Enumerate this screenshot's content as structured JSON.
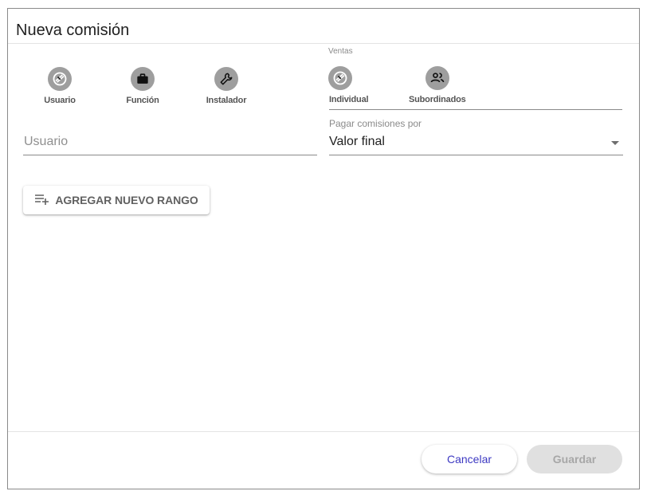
{
  "dialog": {
    "title": "Nueva comisión"
  },
  "assign_type": {
    "options": [
      {
        "label": "Usuario",
        "icon": "user-shield-icon"
      },
      {
        "label": "Función",
        "icon": "briefcase-icon"
      },
      {
        "label": "Instalador",
        "icon": "wrench-icon"
      }
    ]
  },
  "ventas": {
    "label": "Ventas",
    "options": [
      {
        "label": "Individual",
        "icon": "user-shield-icon"
      },
      {
        "label": "Subordinados",
        "icon": "people-icon"
      }
    ]
  },
  "user_field": {
    "placeholder": "Usuario",
    "value": ""
  },
  "pay_by": {
    "label": "Pagar comisiones por",
    "value": "Valor final"
  },
  "add_range": {
    "label": "AGREGAR NUEVO RANGO",
    "icon": "playlist-add-icon"
  },
  "footer": {
    "cancel_label": "Cancelar",
    "save_label": "Guardar"
  },
  "colors": {
    "accent": "#3d39c2",
    "icon_circle": "#9e9e9e",
    "disabled_bg": "#e0e0e0"
  }
}
